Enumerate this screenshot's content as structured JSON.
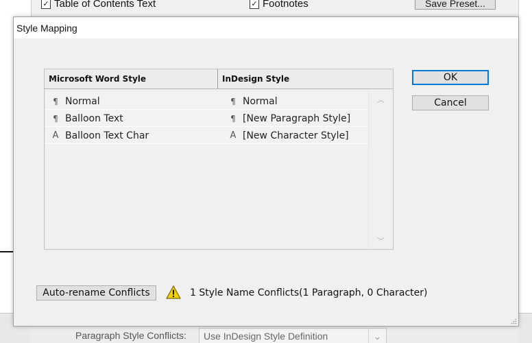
{
  "background": {
    "check_toc_label": "Table of Contents Text",
    "check_footnotes_label": "Footnotes",
    "save_preset_label": "Save Preset...",
    "para_style_conflicts_label": "Paragraph Style Conflicts:",
    "para_style_conflicts_value": "Use InDesign Style Definition"
  },
  "dialog": {
    "title": "Style Mapping",
    "table": {
      "headers": [
        "Microsoft Word Style",
        "InDesign Style"
      ],
      "rows": [
        {
          "word_icon": "paragraph-icon",
          "word_style": "Normal",
          "indesign_icon": "paragraph-icon",
          "indesign_style": "Normal"
        },
        {
          "word_icon": "paragraph-icon",
          "word_style": "Balloon Text",
          "indesign_icon": "paragraph-icon",
          "indesign_style": "[New Paragraph Style]"
        },
        {
          "word_icon": "character-icon",
          "word_style": "Balloon Text Char",
          "indesign_icon": "character-icon",
          "indesign_style": "[New Character Style]"
        }
      ]
    },
    "ok_label": "OK",
    "cancel_label": "Cancel",
    "auto_rename_label": "Auto-rename Conflicts",
    "conflicts_text": "1 Style Name Conflicts(1 Paragraph, 0 Character)"
  },
  "colors": {
    "accent": "#0078d7",
    "dialog_bg": "#f0f0f0",
    "warning": "#f5d000"
  }
}
